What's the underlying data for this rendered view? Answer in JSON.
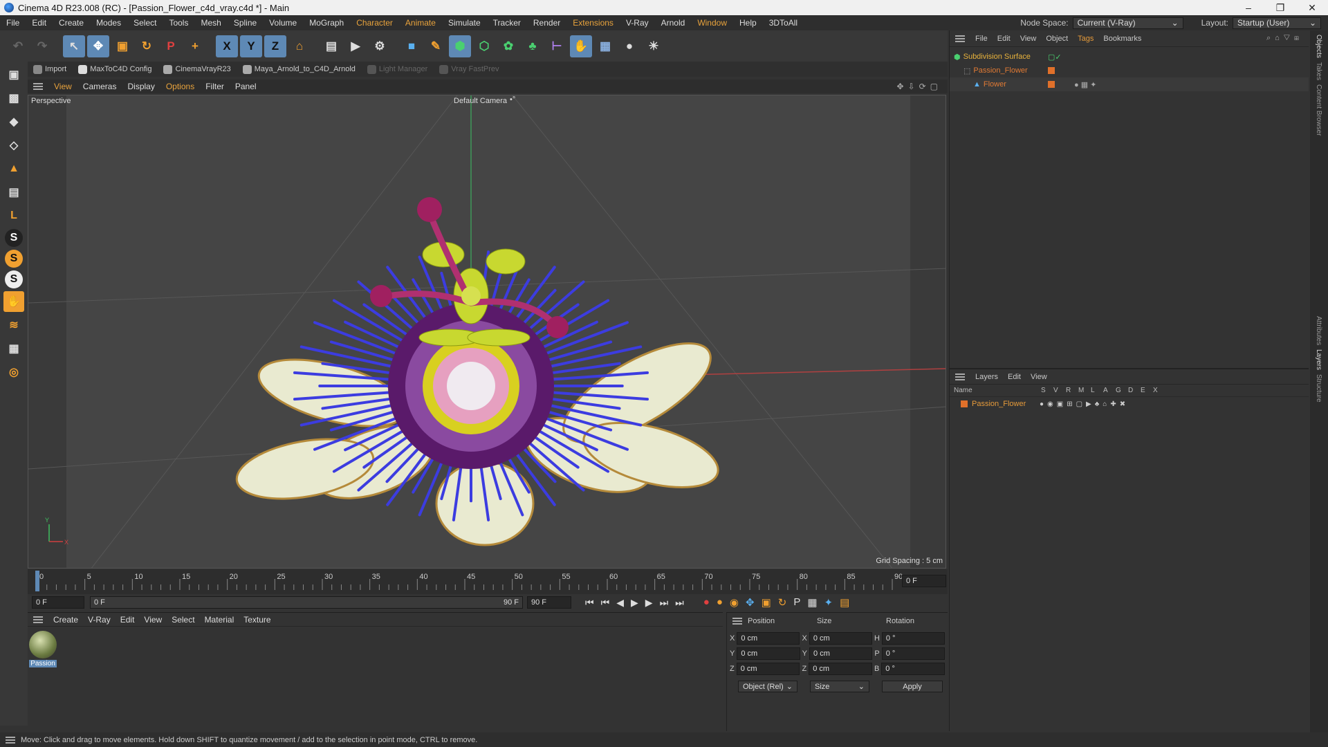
{
  "title": "Cinema 4D R23.008 (RC) - [Passion_Flower_c4d_vray.c4d *] - Main",
  "menu": [
    "File",
    "Edit",
    "Create",
    "Modes",
    "Select",
    "Tools",
    "Mesh",
    "Spline",
    "Volume",
    "MoGraph",
    "Character",
    "Animate",
    "Simulate",
    "Tracker",
    "Render",
    "Extensions",
    "V-Ray",
    "Arnold",
    "Window",
    "Help",
    "3DToAll"
  ],
  "node_space": {
    "label": "Node Space:",
    "value": "Current (V-Ray)"
  },
  "layout": {
    "label": "Layout:",
    "value": "Startup (User)"
  },
  "toolbar": {
    "undo": "↶",
    "redo": "↷",
    "select": "↖",
    "move": "✥",
    "scale": "▣",
    "rotate": "↻",
    "recent": "P",
    "add": "+",
    "x": "X",
    "y": "Y",
    "z": "Z",
    "coord": "⌂",
    "render_view": "▤",
    "render": "▶",
    "render_settings": "⚙",
    "cube": "■",
    "pen": "✎",
    "subdiv": "⬢",
    "extrude": "⬡",
    "mograph": "✿",
    "cloner": "♣",
    "deformer": "⊢",
    "sculpt": "✋",
    "floor": "▦",
    "camera": "●",
    "light": "☀"
  },
  "plugins": [
    {
      "label": "Import",
      "dim": false
    },
    {
      "label": "MaxToC4D Config",
      "dim": false
    },
    {
      "label": "CinemaVrayR23",
      "dim": false
    },
    {
      "label": "Maya_Arnold_to_C4D_Arnold",
      "dim": false
    },
    {
      "label": "Light Manager",
      "dim": true
    },
    {
      "label": "Vray FastPrev",
      "dim": true
    }
  ],
  "left_tools": [
    "▣",
    "▩",
    "◆",
    "◇",
    "▲",
    "▤",
    "L",
    "S",
    "S",
    "S",
    "✋",
    "≋",
    "▦",
    "◎"
  ],
  "viewport_menu": [
    "View",
    "Cameras",
    "Display",
    "Options",
    "Filter",
    "Panel"
  ],
  "viewport": {
    "name": "Perspective",
    "camera": "Default Camera",
    "camera_icon": "•°",
    "grid_spacing": "Grid Spacing : 5 cm",
    "axis_x": "X",
    "axis_y": "Y"
  },
  "timeline": {
    "ticks": [
      "0",
      "5",
      "10",
      "15",
      "20",
      "25",
      "30",
      "35",
      "40",
      "45",
      "50",
      "55",
      "60",
      "65",
      "70",
      "75",
      "80",
      "85",
      "90"
    ],
    "end_field": "0 F"
  },
  "transport": {
    "start": "0 F",
    "current": "0 F",
    "end_range": "90 F",
    "end": "90 F"
  },
  "transport_icons": [
    "⏮",
    "⏮",
    "◀",
    "▶",
    "▶",
    "⏭",
    "⏭"
  ],
  "record_icons": [
    "●",
    "●",
    "◉",
    "✥",
    "▣",
    "↻",
    "P",
    "▦",
    "✦",
    "▤"
  ],
  "material_manager": {
    "menu": [
      "Create",
      "V-Ray",
      "Edit",
      "View",
      "Select",
      "Material",
      "Texture"
    ],
    "material_name": "Passion"
  },
  "attributes": {
    "headers": [
      "Position",
      "Size",
      "Rotation"
    ],
    "rows": [
      {
        "axis": "X",
        "pos": "0 cm",
        "saxis": "X",
        "size": "0 cm",
        "raxis": "H",
        "rot": "0 °"
      },
      {
        "axis": "Y",
        "pos": "0 cm",
        "saxis": "Y",
        "size": "0 cm",
        "raxis": "P",
        "rot": "0 °"
      },
      {
        "axis": "Z",
        "pos": "0 cm",
        "saxis": "Z",
        "size": "0 cm",
        "raxis": "B",
        "rot": "0 °"
      }
    ],
    "mode": "Object (Rel)",
    "size_mode": "Size",
    "apply": "Apply"
  },
  "objects_panel": {
    "menu": [
      "File",
      "Edit",
      "View",
      "Object",
      "Tags",
      "Bookmarks"
    ],
    "items": [
      {
        "name": "Subdivision Surface",
        "indent": 0,
        "color": "#e9b33c"
      },
      {
        "name": "Passion_Flower",
        "indent": 1,
        "color": "#c8642a"
      },
      {
        "name": "Flower",
        "indent": 2,
        "color": "#c8642a"
      }
    ]
  },
  "layers_panel": {
    "menu": [
      "Layers",
      "Edit",
      "View"
    ],
    "columns": [
      "Name",
      "S",
      "V",
      "R",
      "M",
      "L",
      "A",
      "G",
      "D",
      "E",
      "X"
    ],
    "layer": "Passion_Flower"
  },
  "right_tabs": [
    "Objects",
    "Takes",
    "Content Browser",
    "Attributes",
    "Layers",
    "Structure"
  ],
  "status": "Move: Click and drag to move elements. Hold down SHIFT to quantize movement / add to the selection in point mode, CTRL to remove."
}
